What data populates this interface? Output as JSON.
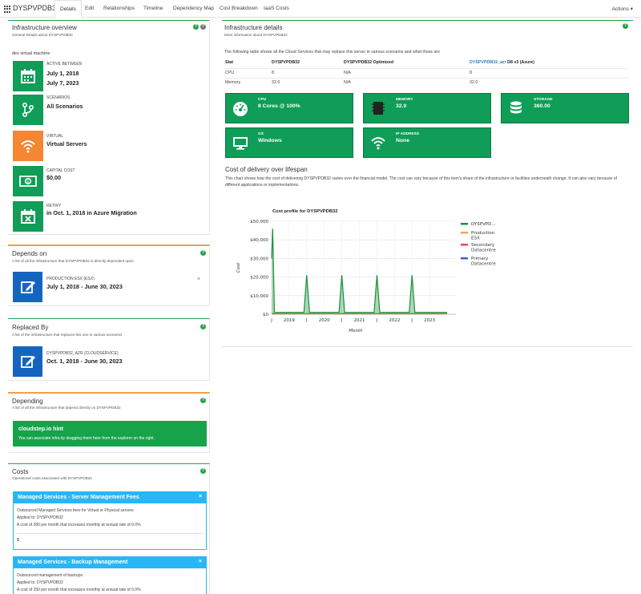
{
  "app": {
    "title": "DYSPVPDB32"
  },
  "tabs": [
    {
      "label": "Details"
    },
    {
      "label": "Edit"
    },
    {
      "label": "Relationships"
    },
    {
      "label": "Timeline"
    },
    {
      "label": "Dependency Map"
    },
    {
      "label": "Cost Breakdown"
    },
    {
      "label": "IaaS Costs"
    }
  ],
  "actions_label": "Actions",
  "overview": {
    "title": "Infrastructure overview",
    "subtitle": "General Details about DYSPVPDB32",
    "machine_type": "dev virtual machine",
    "items": [
      {
        "label": "ACTIVE BETWEEN",
        "value": "July 1, 2018",
        "value2": "July 7, 2023",
        "icon": "calendar-icon",
        "color": "#0f9d58"
      },
      {
        "label": "SCENARIOS",
        "value": "All Scenarios",
        "icon": "branch-icon",
        "color": "#0f9d58"
      },
      {
        "label": "VIRTUAL",
        "value": "Virtual Servers",
        "icon": "wifi-icon",
        "color": "#f58634"
      },
      {
        "label": "CAPITAL COST",
        "value": "$0.00",
        "icon": "money-icon",
        "color": "#0f9d58"
      },
      {
        "label": "RETIRY",
        "value": "in Oct. 1, 2018 in Azure Migration",
        "icon": "calendar-x-icon",
        "color": "#0f9d58"
      }
    ]
  },
  "depends_on": {
    "title": "Depends on",
    "subtitle": "A list of all the infrastructure that DYSPVPDB32 is directly dependent upon",
    "item": {
      "label": "PRODUCTION ESX (ESX)",
      "value": "July 1, 2018 - June 30, 2023",
      "remove": "×"
    }
  },
  "replaced_by": {
    "title": "Replaced By",
    "subtitle": "A list of the infrastructure that replaces this one in various scenarios",
    "item": {
      "label": "DYSPVPDB32_AZR (CLOUDSERVICE)",
      "value": "Oct. 1, 2018 - June 30, 2023"
    }
  },
  "depending": {
    "title": "Depending",
    "subtitle": "A list of all the infrastructure that depend directly on DYSPVPDB32",
    "hint_title": "cloudstep.io hint",
    "hint_text": "You can associate infra by dragging them here from the explorer on the right."
  },
  "costs": {
    "title": "Costs",
    "subtitle": "Operational costs associated with DYSPVPDB32",
    "cards": [
      {
        "title": "Managed Services - Server Management Fees",
        "line1": "Outsourced Managed Services fees for Virtual or Physical servers",
        "line2": "Applied to: DYSPVPDB32",
        "line3": "A cost of 280 per month that increases monthly at annual rate of 0.0%",
        "line4": "$"
      },
      {
        "title": "Managed Services - Backup Management",
        "line1": "Outsourced management of backups",
        "line2": "Applied to: DYSPVPDB32",
        "line3": "A cost of 250 per month that increases monthly at annual rate of 0.0%"
      }
    ]
  },
  "details": {
    "title": "Infrastructure details",
    "subtitle": "More information about DYSPVPDB32",
    "intro": "The following table shows all the Cloud Services that may replace this server in various scenarios and what those are",
    "table": {
      "headers": [
        "Stat",
        "DYSPVPDB32",
        "DYSPVPDB32 Optimized",
        "DYSPVPDB32_azr",
        "D8 v3 (Azure)"
      ],
      "rows": [
        [
          "CPU",
          "8",
          "N/A",
          "8"
        ],
        [
          "Memory",
          "32.0",
          "N/A",
          "32.0"
        ]
      ]
    },
    "tiles": [
      {
        "label": "CPU",
        "value": "8 Cores @ 100%",
        "icon": "speedometer-icon"
      },
      {
        "label": "MEMORY",
        "value": "32.0",
        "icon": "memory-icon"
      },
      {
        "label": "STORAGE",
        "value": "360.00",
        "icon": "database-icon"
      },
      {
        "label": "OS",
        "value": "Windows",
        "icon": "monitor-icon"
      },
      {
        "label": "IP ADDRESS",
        "value": "None",
        "icon": "wifi-icon"
      }
    ]
  },
  "cost_delivery": {
    "title": "Cost of delivery over lifespan",
    "description": "This chart shows how the cost of delivering DYSPVPDB32 varies over the financial model. The cost can vary because of this item's share of the infrastructure or facilities underneath change. It can also vary because of different applications or implementations."
  },
  "chart_data": {
    "type": "area",
    "title": "Cost profile for DYSPVPDB32",
    "xlabel": "Month",
    "ylabel": "Cost",
    "ylim": [
      0,
      50000
    ],
    "yticks": [
      "$0",
      "$10,000",
      "$20,000",
      "$30,000",
      "$40,000",
      "$50,000"
    ],
    "xticks": [
      "J",
      "2019",
      "J",
      "2020",
      "J",
      "2021",
      "J",
      "2022",
      "J",
      "2023"
    ],
    "grid": true,
    "legend_position": "right",
    "series": [
      {
        "name": "DYSPVPD...",
        "color": "#1a8f3a",
        "x": [
          2018.5,
          2018.53,
          2018.58,
          2019.42,
          2019.5,
          2019.58,
          2020.42,
          2020.5,
          2020.58,
          2021.42,
          2021.5,
          2021.58,
          2022.42,
          2022.5,
          2022.58,
          2023.5
        ],
        "y": [
          30000,
          46000,
          1000,
          1000,
          21000,
          1000,
          1000,
          21000,
          1000,
          1000,
          21000,
          1000,
          1000,
          21000,
          1000,
          1000
        ]
      },
      {
        "name": "Production ESX",
        "color": "#f5a454",
        "x": [
          2018.5,
          2023.5
        ],
        "y": [
          500,
          500
        ]
      },
      {
        "name": "Secondary Datacentre",
        "color": "#e54848",
        "x": [
          2018.5,
          2023.5
        ],
        "y": [
          300,
          300
        ]
      },
      {
        "name": "Primary Datacentre",
        "color": "#3b5ec9",
        "x": [
          2018.5,
          2023.5
        ],
        "y": [
          200,
          200
        ]
      }
    ]
  }
}
